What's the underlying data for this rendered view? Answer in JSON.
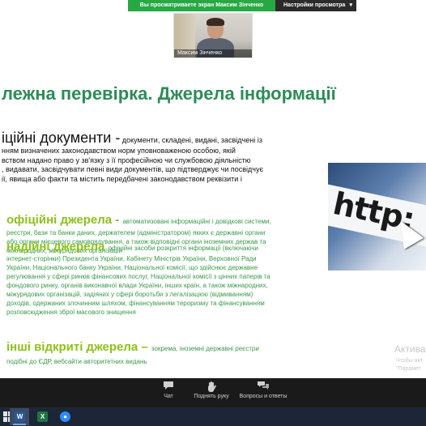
{
  "share_bar": {
    "banner": "Вы просматриваете экран Максим Зінченко",
    "view_options": "Настройки просмотра",
    "view_options_chevron": "▾"
  },
  "video": {
    "participant_name": "Максим Зінченко"
  },
  "slide": {
    "title": "лежна перевірка. Джерела інформації",
    "docs_heading": "іційні документи -",
    "docs_desc": " документи, складені, видані, засвідчені із",
    "docs_lines": [
      "нням визначених законодавством норм уповноваженою особою, якій",
      "вством надано право у зв'язку з її професійною чи службовою діяльністю",
      ", видавати, засвідчувати певні види документів, що підтверджує чи посвідчує",
      "ії, явища або факти та містить передбачені законодавством реквізити і"
    ],
    "sections": [
      {
        "title": "офіційні джерела - ",
        "inline": "автоматизовані інформаційні і довідкові системи,",
        "lines": [
          "реєстри, бази та банки даних, держателем (адміністратором) якких є державні органи",
          "або органи місцевого самоврядування, а також відповідні органи іноземних держав та",
          "міжнародних, міжурядових організацій"
        ]
      },
      {
        "title": "надійні джерела ",
        "inline": "офіційні засоби розкриття інформації (включаючи",
        "lines": [
          "інтернет-сторінки) Президента України, Кабінету Міністрів України, Верховної Ради",
          "України, Національного банку України, Національної комісії, що здійснює державне",
          "регулювання у сфері ринків фінансових послуг, Національної комісії з цінних паперів та",
          "фондового ринку, органів виконавчої влади України, інших країн, а також міжнародних,",
          "міжурядових організацій, задіяних у сфері боротьби з легалізацією (відмиванням)",
          "доходів, одержаних злочинним шляхом, фінансуванням тероризму та фінансуванням",
          "розповсюдження зброї масового знищення"
        ]
      },
      {
        "title": "інші відкриті джерела – ",
        "inline": "зокрема, іноземні державні реєстри",
        "lines": [
          "подібні до ЄДР, вебсайти авторитетних видань"
        ]
      }
    ],
    "image_text": "http:",
    "watermark_title": "Актива",
    "watermark_lines": [
      "Чтобы акт",
      "\"Парамет"
    ]
  },
  "toolbar": [
    {
      "name": "chat",
      "label": "Чат",
      "icon": "chat-bubble-icon"
    },
    {
      "name": "raise-hand",
      "label": "Поднять руку",
      "icon": "hand-icon"
    },
    {
      "name": "qa",
      "label": "Вопросы и ответы",
      "icon": "qa-icon"
    }
  ],
  "taskbar": {
    "apps": [
      {
        "name": "word",
        "letter": "W",
        "color": "#2b579a"
      },
      {
        "name": "excel",
        "letter": "X",
        "color": "#217346"
      },
      {
        "name": "zoom",
        "letter": "●",
        "color": "#2d8cff"
      }
    ]
  }
}
